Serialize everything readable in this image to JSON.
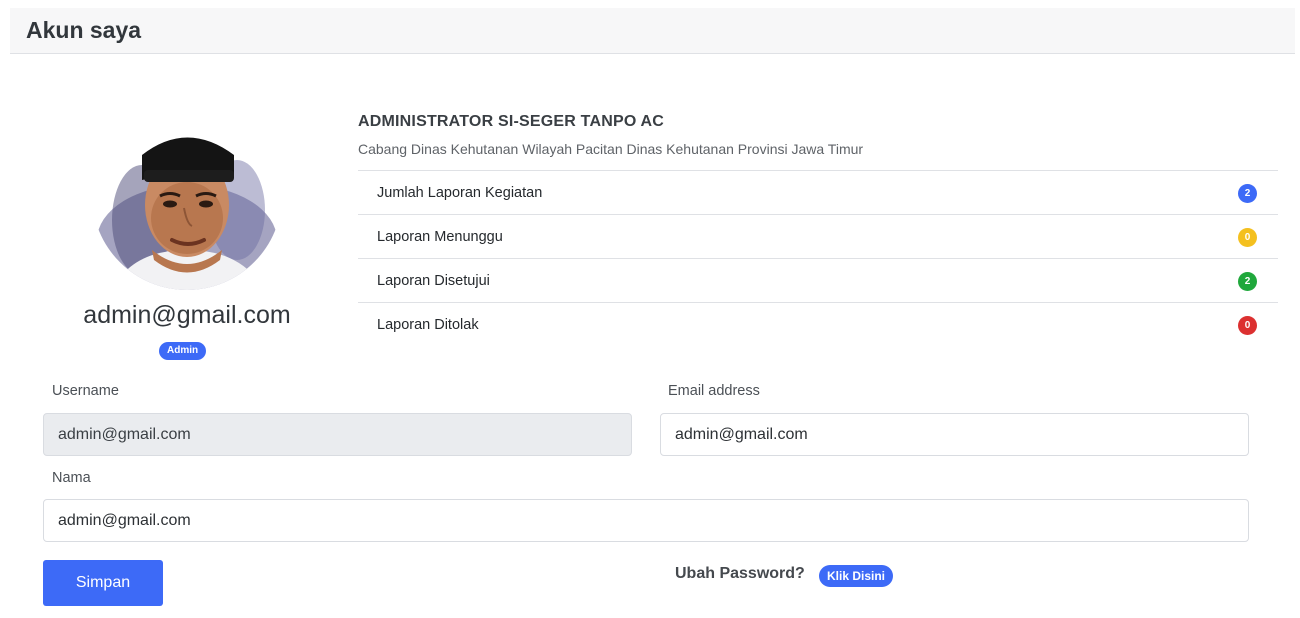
{
  "page": {
    "title": "Akun saya"
  },
  "profile": {
    "display_name": "admin@gmail.com",
    "role_badge": "Admin",
    "avatar_icon": "user-avatar-photo"
  },
  "organization": {
    "title": "ADMINISTRATOR SI-SEGER TANPO AC",
    "subtitle": "Cabang Dinas Kehutanan Wilayah Pacitan Dinas Kehutanan Provinsi Jawa Timur"
  },
  "stats": [
    {
      "label": "Jumlah Laporan Kegiatan",
      "count": "2",
      "color": "#3d6af7"
    },
    {
      "label": "Laporan Menunggu",
      "count": "0",
      "color": "#f4c01f"
    },
    {
      "label": "Laporan Disetujui",
      "count": "2",
      "color": "#20a83c"
    },
    {
      "label": "Laporan Ditolak",
      "count": "0",
      "color": "#dc3030"
    }
  ],
  "form": {
    "username_label": "Username",
    "username_value": "admin@gmail.com",
    "email_label": "Email address",
    "email_value": "admin@gmail.com",
    "name_label": "Nama",
    "name_value": "admin@gmail.com",
    "save_label": "Simpan"
  },
  "password": {
    "prompt": "Ubah Password?",
    "link_label": "Klik Disini"
  },
  "colors": {
    "primary": "#3d6af7"
  }
}
